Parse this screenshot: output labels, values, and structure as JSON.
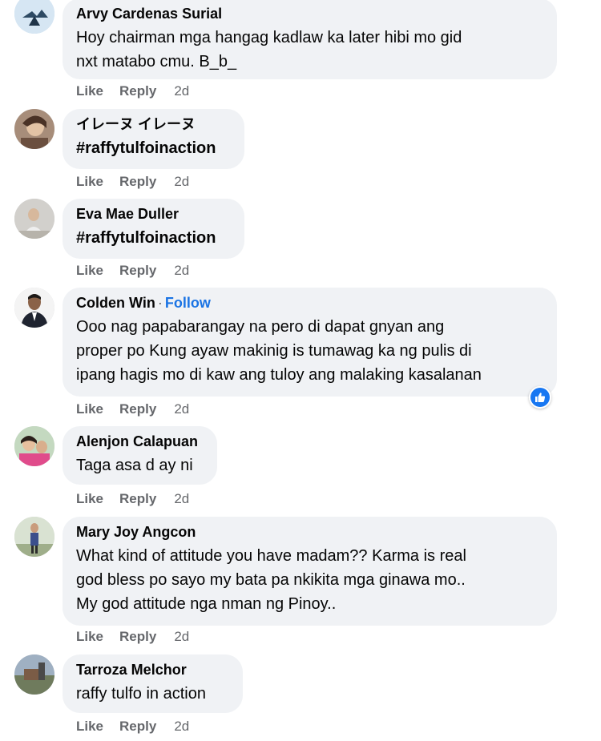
{
  "colors": {
    "bubble": "#f0f2f5",
    "text": "#050505",
    "muted": "#65676b",
    "link": "#1b74e4",
    "like_blue": "#1877f2"
  },
  "comments": [
    {
      "name": "Arvy Cardenas Surial",
      "lines": [
        "Hoy chairman mga hangag kadlaw ka later hibi mo gid",
        "nxt matabo cmu. B_b_"
      ],
      "like": "Like",
      "reply": "Reply",
      "time": "2d"
    },
    {
      "name": "イレーヌ イレーヌ",
      "lines": [
        "#raffytulfoinaction"
      ],
      "like": "Like",
      "reply": "Reply",
      "time": "2d"
    },
    {
      "name": "Eva Mae Duller",
      "lines": [
        "#raffytulfoinaction"
      ],
      "like": "Like",
      "reply": "Reply",
      "time": "2d"
    },
    {
      "name": "Colden Win",
      "separator": "·",
      "follow": "Follow",
      "lines": [
        "Ooo nag papabarangay na pero di dapat gnyan ang",
        "proper po Kung ayaw makinig is tumawag ka ng pulis di",
        "ipang hagis mo di kaw ang tuloy ang malaking kasalanan"
      ],
      "reaction_icon": "like-reaction-icon",
      "like": "Like",
      "reply": "Reply",
      "time": "2d"
    },
    {
      "name": "Alenjon Calapuan",
      "lines": [
        "Taga asa d ay ni"
      ],
      "like": "Like",
      "reply": "Reply",
      "time": "2d"
    },
    {
      "name": "Mary Joy Angcon",
      "lines": [
        "What kind of attitude you have madam?? Karma is real",
        "god bless po sayo my bata pa nkikita mga ginawa mo..",
        "My god attitude nga nman ng Pinoy.."
      ],
      "like": "Like",
      "reply": "Reply",
      "time": "2d"
    },
    {
      "name": "Tarroza Melchor",
      "lines": [
        "raffy tulfo in action"
      ],
      "like": "Like",
      "reply": "Reply",
      "time": "2d"
    }
  ]
}
